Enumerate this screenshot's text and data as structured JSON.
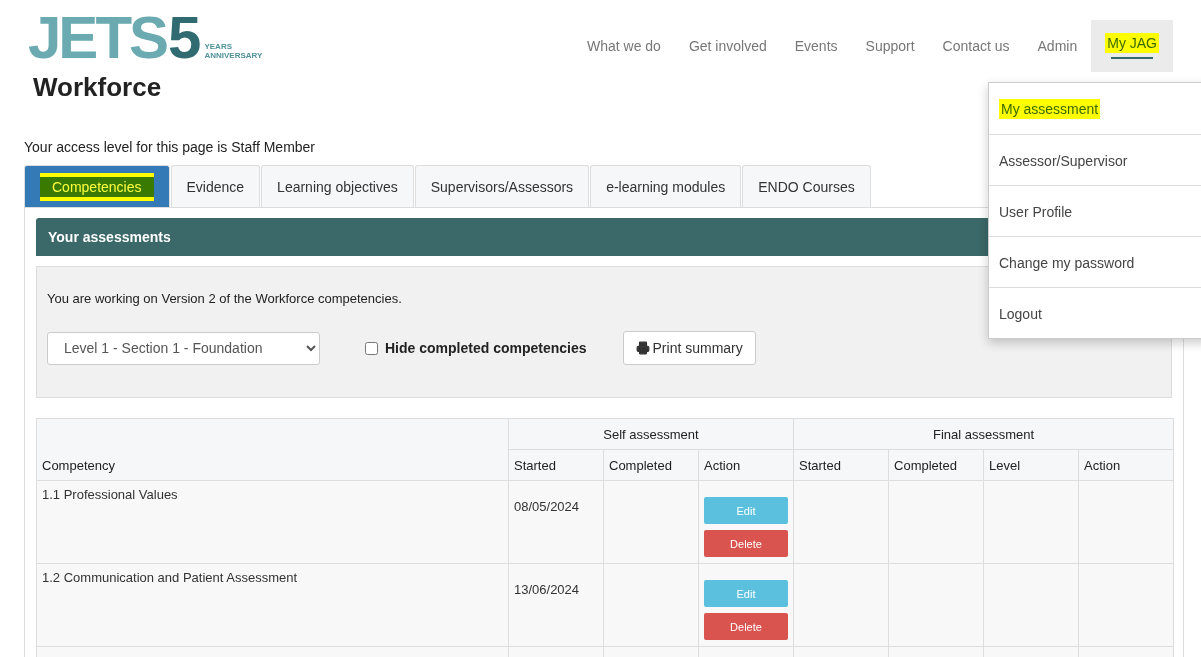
{
  "logo": {
    "mark": "JETS",
    "number": "5",
    "anniversary": "YEARS ANNIVERSARY",
    "subtitle": "Workforce"
  },
  "nav": [
    {
      "label": "What we do",
      "active": false,
      "highlighted": false
    },
    {
      "label": "Get involved",
      "active": false,
      "highlighted": false
    },
    {
      "label": "Events",
      "active": false,
      "highlighted": false
    },
    {
      "label": "Support",
      "active": false,
      "highlighted": false
    },
    {
      "label": "Contact us",
      "active": false,
      "highlighted": false
    },
    {
      "label": "Admin",
      "active": false,
      "highlighted": false
    },
    {
      "label": "My JAG",
      "active": true,
      "highlighted": true
    }
  ],
  "dropdown": [
    {
      "label": "My assessment",
      "highlighted": true
    },
    {
      "label": "Assessor/Supervisor",
      "highlighted": false
    },
    {
      "label": "User Profile",
      "highlighted": false
    },
    {
      "label": "Change my password",
      "highlighted": false
    },
    {
      "label": "Logout",
      "highlighted": false
    }
  ],
  "access_text": "Your access level for this page is Staff Member",
  "tabs": [
    {
      "label": "Competencies",
      "selected": true,
      "highlighted": true
    },
    {
      "label": "Evidence",
      "selected": false,
      "highlighted": false
    },
    {
      "label": "Learning objectives",
      "selected": false,
      "highlighted": false
    },
    {
      "label": "Supervisors/Assessors",
      "selected": false,
      "highlighted": false
    },
    {
      "label": "e-learning modules",
      "selected": false,
      "highlighted": false
    },
    {
      "label": "ENDO Courses",
      "selected": false,
      "highlighted": false
    }
  ],
  "panel_title": "Your assessments",
  "version_text": "You are working on Version 2 of the Workforce competencies.",
  "section_select": {
    "value": "Level 1 - Section 1 - Foundation"
  },
  "hide_completed": {
    "label": "Hide completed competencies",
    "checked": false
  },
  "print_button": "Print summary",
  "table": {
    "groups": [
      "Self assessment",
      "Final assessment"
    ],
    "competency_header": "Competency",
    "self_columns": [
      "Started",
      "Completed",
      "Action"
    ],
    "final_columns": [
      "Started",
      "Completed",
      "Level",
      "Action"
    ],
    "rows": [
      {
        "competency": "1.1 Professional Values",
        "self_started": "08/05/2024",
        "actions": [
          {
            "label": "Edit",
            "kind": "edit"
          },
          {
            "label": "Delete",
            "kind": "delete"
          }
        ]
      },
      {
        "competency": "1.2 Communication and Patient Assessment",
        "self_started": "13/06/2024",
        "actions": [
          {
            "label": "Edit",
            "kind": "edit"
          },
          {
            "label": "Delete",
            "kind": "delete"
          }
        ]
      }
    ]
  }
}
